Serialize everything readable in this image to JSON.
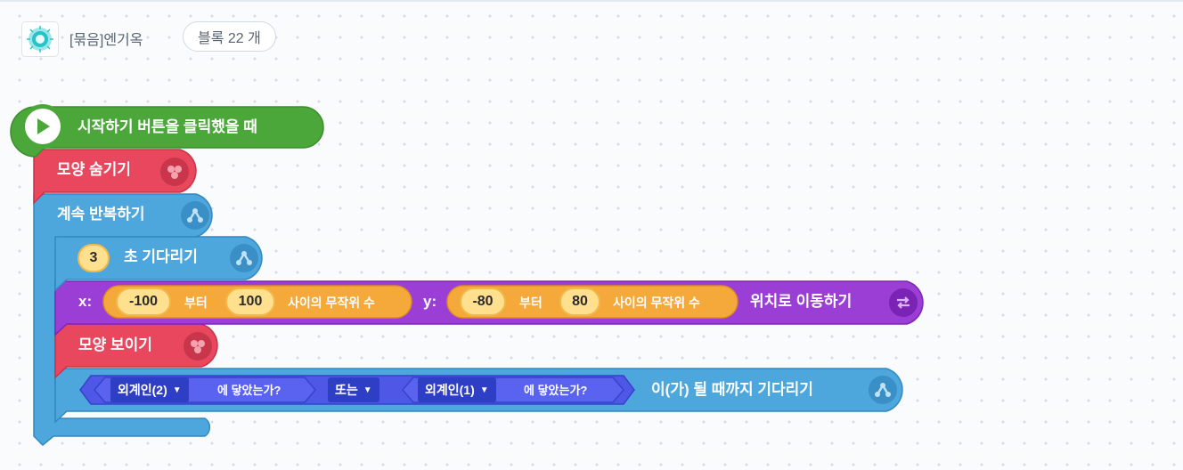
{
  "header": {
    "object_name": "[묶음]엔기옥",
    "block_count_label": "블록 22 개"
  },
  "icons": {
    "start": "play-icon",
    "looks": "looks-icon",
    "flow": "flow-icon",
    "move": "move-icon"
  },
  "colors": {
    "start": "#4ca73b",
    "looks": "#e8475e",
    "flow": "#4ea7dc",
    "move": "#9a3ed6",
    "calc": "#f4a93a",
    "judge": "#4f58e6"
  },
  "blocks": {
    "when_start": {
      "label": "시작하기 버튼을 클릭했을 때"
    },
    "hide": {
      "label": "모양 숨기기"
    },
    "repeat_forever": {
      "label": "계속 반복하기"
    },
    "wait": {
      "seconds": "3",
      "label": "초 기다리기"
    },
    "move_to": {
      "x_label": "x:",
      "x_from": "-100",
      "x_between": "부터",
      "x_to": "100",
      "x_suffix": "사이의 무작위 수",
      "y_label": "y:",
      "y_from": "-80",
      "y_between": "부터",
      "y_to": "80",
      "y_suffix": "사이의 무작위 수",
      "label": "위치로 이동하기"
    },
    "show": {
      "label": "모양 보이기"
    },
    "wait_until": {
      "target1": "외계인(2)",
      "touch1": "에 닿았는가?",
      "operator": "또는",
      "target2": "외계인(1)",
      "touch2": "에 닿았는가?",
      "label": "이(가) 될 때까지 기다리기"
    }
  }
}
